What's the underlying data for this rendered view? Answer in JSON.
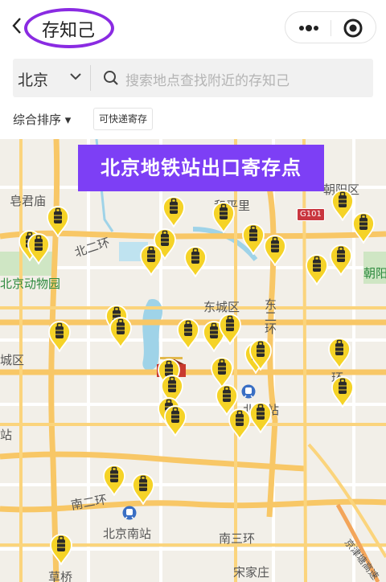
{
  "header": {
    "title": "存知己"
  },
  "search": {
    "city": "北京",
    "placeholder": "搜索地点查找附近的存知己"
  },
  "filters": {
    "sort_label": "综合排序 ▾",
    "express_label": "可快递寄存"
  },
  "banner": {
    "text": "北京地铁站出口寄存点"
  },
  "map_labels": {
    "zaojunmiao": "皂君庙",
    "heping": "和平里",
    "chaoyang_district": "朝阳区",
    "g101": "G101",
    "north2ring": "北二环",
    "zoo": "北京动物园",
    "chaoyang_short": "朝阳",
    "dongcheng": "东城区",
    "east2ring": "东二环",
    "cheng_district": "城区",
    "beijing_station": "北京站",
    "south2ring": "南二环",
    "beijing_south": "北京南站",
    "south3ring": "南三环",
    "caoqiao": "草桥",
    "songjiazhuang": "宋家庄",
    "huan": "环",
    "zhan": "站",
    "jingjin": "京津塘高速"
  },
  "icons": {
    "back": "chevron-left-icon",
    "more": "more-dots-icon",
    "target": "target-icon",
    "chevron": "chevron-down-icon",
    "search": "search-icon",
    "pin": "luggage-pin-icon",
    "train": "train-station-icon",
    "gate": "tiananmen-icon"
  },
  "colors": {
    "accent": "#7d3ff5",
    "title_ring": "#8a2be2",
    "pin": "#f5d327",
    "road": "#f8c766"
  }
}
